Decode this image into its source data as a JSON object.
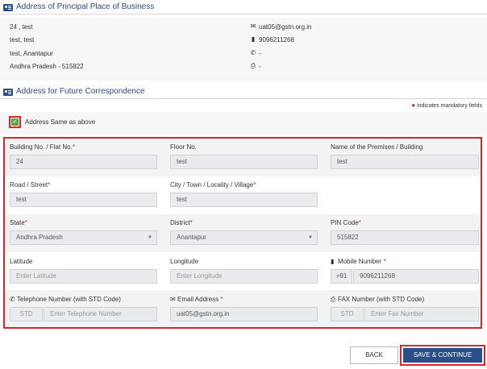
{
  "principal": {
    "title": "Address of Principal Place of Business",
    "lines": [
      "24 , test",
      "test, test",
      "test, Anantapur",
      "Andhra Pradesh - 515822"
    ],
    "email": "uat05@gstn.org.in",
    "mobile": "9096211268",
    "telephone": "-",
    "fax": "-"
  },
  "future": {
    "title": "Address for Future Correspondence",
    "mandatory_note": "indicates mandatory fields",
    "same_label": "Address Same as above",
    "same_checked": true
  },
  "form": {
    "building": {
      "label": "Building No. / Flat No.",
      "value": "24"
    },
    "floor": {
      "label": "Floor No.",
      "value": "test"
    },
    "premises": {
      "label": "Name of the Premises / Building",
      "value": "test"
    },
    "road": {
      "label": "Road / Street",
      "value": "test"
    },
    "city": {
      "label": "City / Town / Locality / Village",
      "value": "test"
    },
    "state": {
      "label": "State",
      "value": "Andhra Pradesh"
    },
    "district": {
      "label": "District",
      "value": "Anantapur"
    },
    "pin": {
      "label": "PIN Code",
      "value": "515822"
    },
    "latitude": {
      "label": "Latitude",
      "placeholder": "Enter Latitude"
    },
    "longitude": {
      "label": "Longitude",
      "placeholder": "Enter Longitude"
    },
    "mobile": {
      "label": "Mobile Number",
      "prefix": "+91",
      "value": "9096211268"
    },
    "telephone": {
      "label": "Telephone Number (with STD Code)",
      "std": "STD",
      "placeholder": "Enter Telephone Number"
    },
    "email": {
      "label": "Email Address",
      "value": "uat05@gstn.org.in"
    },
    "fax": {
      "label": "FAX Number (with STD Code)",
      "std": "STD",
      "placeholder": "Enter Fax Number"
    }
  },
  "buttons": {
    "back": "BACK",
    "save": "SAVE & CONTINUE"
  },
  "icons": {
    "card": "id-card-icon",
    "email": "envelope-icon",
    "mobile": "mobile-phone-icon",
    "telephone": "telephone-icon",
    "fax": "fax-icon",
    "checkbox": "check-icon",
    "dropdown": "caret-down-icon"
  },
  "colors": {
    "brand": "#2c4e86",
    "required": "#d9232d",
    "check": "#5aa73c",
    "highlight": "#d9232d"
  }
}
